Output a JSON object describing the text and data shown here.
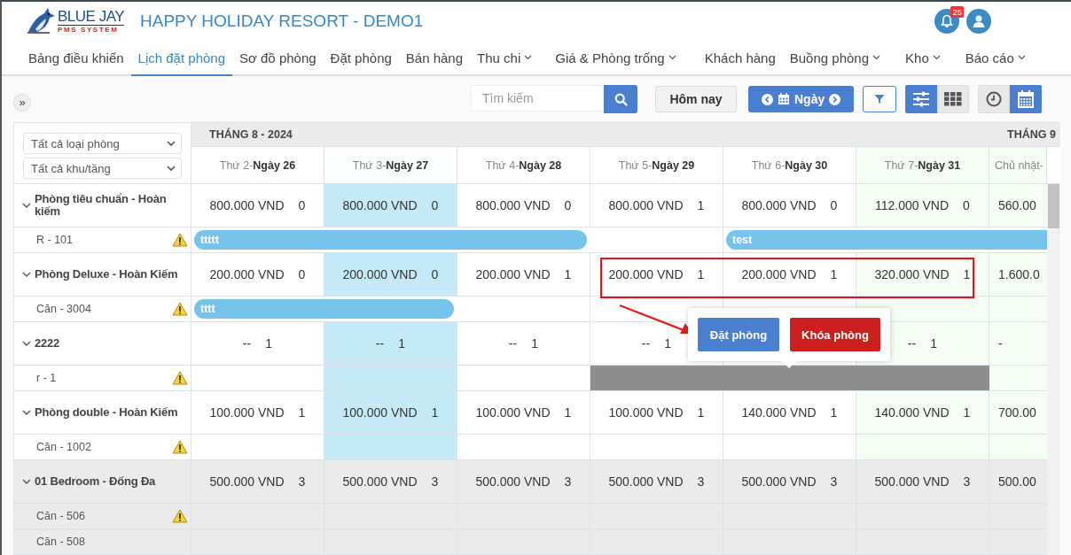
{
  "header": {
    "logo": {
      "name": "BLUE JAY",
      "tagline": "PMS SYSTEM"
    },
    "title": "HAPPY HOLIDAY RESORT - DEMO1",
    "notifications": {
      "count": "25"
    }
  },
  "nav": [
    {
      "label": "Bảng điều khiển",
      "selected": false,
      "has_menu": false
    },
    {
      "label": "Lịch đặt phòng",
      "selected": true,
      "has_menu": false
    },
    {
      "label": "Sơ đồ phòng",
      "selected": false,
      "has_menu": false
    },
    {
      "label": "Đặt phòng",
      "selected": false,
      "has_menu": false
    },
    {
      "label": "Bán hàng",
      "selected": false,
      "has_menu": false
    },
    {
      "label": "Thu chi",
      "selected": false,
      "has_menu": true
    },
    {
      "label": "Giá & Phòng trống",
      "selected": false,
      "has_menu": true
    },
    {
      "label": "Khách hàng",
      "selected": false,
      "has_menu": false
    },
    {
      "label": "Buồng phòng",
      "selected": false,
      "has_menu": true
    },
    {
      "label": "Kho",
      "selected": false,
      "has_menu": true
    },
    {
      "label": "Báo cáo",
      "selected": false,
      "has_menu": true
    }
  ],
  "toolbar": {
    "expand_button": "»",
    "search": {
      "placeholder": "Tìm kiếm"
    },
    "today_button": "Hôm nay",
    "period_button": "Ngày",
    "view_toggles": [
      {
        "kind": "sliders",
        "selected": true
      },
      {
        "kind": "grid",
        "selected": false
      }
    ],
    "mode_toggles": [
      {
        "kind": "clock",
        "selected": false
      },
      {
        "kind": "calendar",
        "selected": true
      }
    ]
  },
  "filters": [
    {
      "value": "Tất cả loại phòng"
    },
    {
      "value": "Tất cả khu/tầng"
    }
  ],
  "months": [
    {
      "label": "THÁNG 8 - 2024",
      "days": [
        {
          "weekday": "Thứ 2-",
          "day": "Ngày 26",
          "today": false,
          "weekend": false
        },
        {
          "weekday": "Thứ 3-",
          "day": "Ngày 27",
          "today": true,
          "weekend": false
        },
        {
          "weekday": "Thứ 4-",
          "day": "Ngày 28",
          "today": false,
          "weekend": false
        },
        {
          "weekday": "Thứ 5-",
          "day": "Ngày 29",
          "today": false,
          "weekend": false
        },
        {
          "weekday": "Thứ 6-",
          "day": "Ngày 30",
          "today": false,
          "weekend": false
        },
        {
          "weekday": "Thứ 7-",
          "day": "Ngày 31",
          "today": false,
          "weekend": true
        }
      ]
    },
    {
      "label": "THÁNG 9",
      "days": [
        {
          "weekday": "Chủ nhật-",
          "today": false,
          "weekend": true
        }
      ]
    }
  ],
  "rows": [
    {
      "kind": "room_type",
      "name": "Phòng tiêu chuẩn - Hoàn kiếm",
      "expanded": true,
      "shaded": false,
      "cells": [
        {
          "price": "800.000 VND",
          "count": "0"
        },
        {
          "price": "800.000 VND",
          "count": "0"
        },
        {
          "price": "800.000 VND",
          "count": "0"
        },
        {
          "price": "800.000 VND",
          "count": "1"
        },
        {
          "price": "800.000 VND",
          "count": "0"
        },
        {
          "price": "112.000 VND",
          "count": "0"
        },
        {
          "price": "560.00"
        }
      ]
    },
    {
      "kind": "room",
      "name": "R - 101",
      "warning": true,
      "shaded": false,
      "cells": [
        {
          "booked": true,
          "blocked": false
        },
        {
          "booked": true,
          "blocked": false
        },
        {
          "booked": true,
          "blocked": false
        },
        {
          "booked": false,
          "blocked": false
        },
        {
          "booked": true,
          "blocked": false
        },
        {
          "booked": true,
          "blocked": false
        },
        {
          "booked": true,
          "blocked": false
        }
      ],
      "bookings": [
        "ttttt",
        "test"
      ]
    },
    {
      "kind": "room_type",
      "name": "Phòng Deluxe - Hoàn Kiếm",
      "expanded": true,
      "shaded": false,
      "cells": [
        {
          "price": "200.000 VND",
          "count": "0"
        },
        {
          "price": "200.000 VND",
          "count": "0"
        },
        {
          "price": "200.000 VND",
          "count": "1"
        },
        {
          "price": "200.000 VND",
          "count": "1"
        },
        {
          "price": "200.000 VND",
          "count": "1"
        },
        {
          "price": "320.000 VND",
          "count": "1"
        },
        {
          "price": "1.600.0"
        }
      ]
    },
    {
      "kind": "room",
      "name": "Căn - 3004",
      "warning": true,
      "shaded": false,
      "cells": [
        {
          "booked": true,
          "blocked": false
        },
        {
          "booked": true,
          "blocked": false
        },
        {
          "booked": false,
          "blocked": false
        },
        {
          "booked": false,
          "blocked": false
        },
        {
          "booked": false,
          "blocked": false
        },
        {
          "booked": false,
          "blocked": false
        },
        {
          "booked": false,
          "blocked": false
        }
      ],
      "bookings": [
        "tttt"
      ]
    },
    {
      "kind": "room_type",
      "name": "2222",
      "expanded": true,
      "shaded": false,
      "cells": [
        {
          "price": "--",
          "count": "1"
        },
        {
          "price": "--",
          "count": "1"
        },
        {
          "price": "--",
          "count": "1"
        },
        {
          "price": "--",
          "count": "1"
        },
        {},
        {
          "price": "--",
          "count": "1"
        },
        {
          "price": "-"
        }
      ]
    },
    {
      "kind": "room",
      "name": "r - 1",
      "warning": true,
      "shaded": false,
      "cells": [
        {
          "booked": false,
          "blocked": false
        },
        {
          "booked": false,
          "blocked": false
        },
        {
          "booked": false,
          "blocked": false
        },
        {
          "booked": false,
          "blocked": true
        },
        {
          "booked": false,
          "blocked": true
        },
        {
          "booked": false,
          "blocked": true
        },
        {
          "booked": false,
          "blocked": false
        }
      ]
    },
    {
      "kind": "room_type",
      "name": "Phòng double - Hoàn Kiếm",
      "expanded": true,
      "shaded": false,
      "cells": [
        {
          "price": "100.000 VND",
          "count": "1"
        },
        {
          "price": "100.000 VND",
          "count": "1"
        },
        {
          "price": "100.000 VND",
          "count": "1"
        },
        {
          "price": "100.000 VND",
          "count": "1"
        },
        {
          "price": "140.000 VND",
          "count": "1"
        },
        {
          "price": "140.000 VND",
          "count": "1"
        },
        {
          "price": "700.00"
        }
      ]
    },
    {
      "kind": "room",
      "name": "Căn - 1002",
      "warning": true,
      "shaded": false,
      "cells": [
        {
          "booked": false,
          "blocked": false
        },
        {
          "booked": false,
          "blocked": false
        },
        {
          "booked": false,
          "blocked": false
        },
        {
          "booked": false,
          "blocked": false
        },
        {
          "booked": false,
          "blocked": false
        },
        {
          "booked": false,
          "blocked": false
        },
        {
          "booked": false,
          "blocked": false
        }
      ]
    },
    {
      "kind": "room_type",
      "name": "01 Bedroom - Đống Đa",
      "expanded": true,
      "shaded": true,
      "cells": [
        {
          "price": "500.000 VND",
          "count": "3"
        },
        {
          "price": "500.000 VND",
          "count": "3"
        },
        {
          "price": "500.000 VND",
          "count": "3"
        },
        {
          "price": "500.000 VND",
          "count": "3"
        },
        {
          "price": "500.000 VND",
          "count": "3"
        },
        {
          "price": "500.000 VND",
          "count": "3"
        },
        {
          "price": "500.00"
        }
      ]
    },
    {
      "kind": "room",
      "name": "Căn - 506",
      "warning": true,
      "shaded": true,
      "cells": [
        {
          "booked": false,
          "blocked": false
        },
        {
          "booked": false,
          "blocked": false
        },
        {
          "booked": false,
          "blocked": false
        },
        {
          "booked": false,
          "blocked": false
        },
        {
          "booked": false,
          "blocked": false
        },
        {
          "booked": false,
          "blocked": false
        },
        {
          "booked": false,
          "blocked": false
        }
      ]
    },
    {
      "kind": "room",
      "name": "Căn - 508",
      "warning": false,
      "shaded": true,
      "cells": [
        {
          "booked": false,
          "blocked": false
        },
        {
          "booked": false,
          "blocked": false
        },
        {
          "booked": false,
          "blocked": false
        },
        {
          "booked": false,
          "blocked": false
        },
        {
          "booked": false,
          "blocked": false
        },
        {
          "booked": false,
          "blocked": false
        },
        {
          "booked": false,
          "blocked": false
        }
      ]
    }
  ],
  "popup": {
    "buttons": [
      {
        "label": "Đặt phòng",
        "kind": "primary"
      },
      {
        "label": "Khóa phòng",
        "kind": "danger"
      }
    ]
  }
}
